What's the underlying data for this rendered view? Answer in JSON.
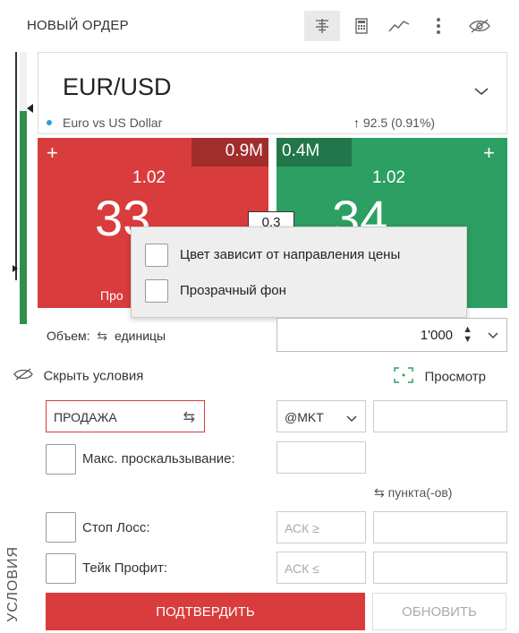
{
  "header": {
    "title": "НОВЫЙ ОРДЕР",
    "icons": [
      "layout-icon",
      "calculator-icon",
      "chart-icon",
      "more-icon",
      "hide-icon"
    ]
  },
  "instrument": {
    "symbol": "EUR/USD",
    "description": "Euro vs US Dollar",
    "change": "92.5 (0.91%)"
  },
  "sell_tile": {
    "plus": "+",
    "volume": "0.9M",
    "price_top": "1.02",
    "price_big": "33",
    "label": "Про"
  },
  "buy_tile": {
    "plus": "+",
    "volume": "0.4M",
    "price_top": "1.02",
    "price_big": "34"
  },
  "spread": "0.3",
  "popup": {
    "option1": "Цвет зависит от направления цены",
    "option2": "Прозрачный фон"
  },
  "volume_row": {
    "label": "Объем:",
    "units": "единицы",
    "value": "1'000"
  },
  "conditions": {
    "hide_label": "Скрыть условия",
    "preview_label": "Просмотр"
  },
  "order": {
    "side": "ПРОДАЖА",
    "type": "@MKT",
    "slippage_label": "Макс. проскальзывание:",
    "points_label": "пункта(-ов)",
    "stop_loss_label": "Стоп Лосс:",
    "take_profit_label": "Тейк Профит:",
    "sl_placeholder": "АСК ≥",
    "tp_placeholder": "АСК ≤",
    "vertical_label": "УСЛОВИЯ"
  },
  "buttons": {
    "confirm": "ПОДТВЕРДИТЬ",
    "update": "ОБНОВИТЬ"
  },
  "colors": {
    "sell": "#d93c3c",
    "buy": "#2c9f62",
    "accent_blue": "#2aa0d4"
  }
}
